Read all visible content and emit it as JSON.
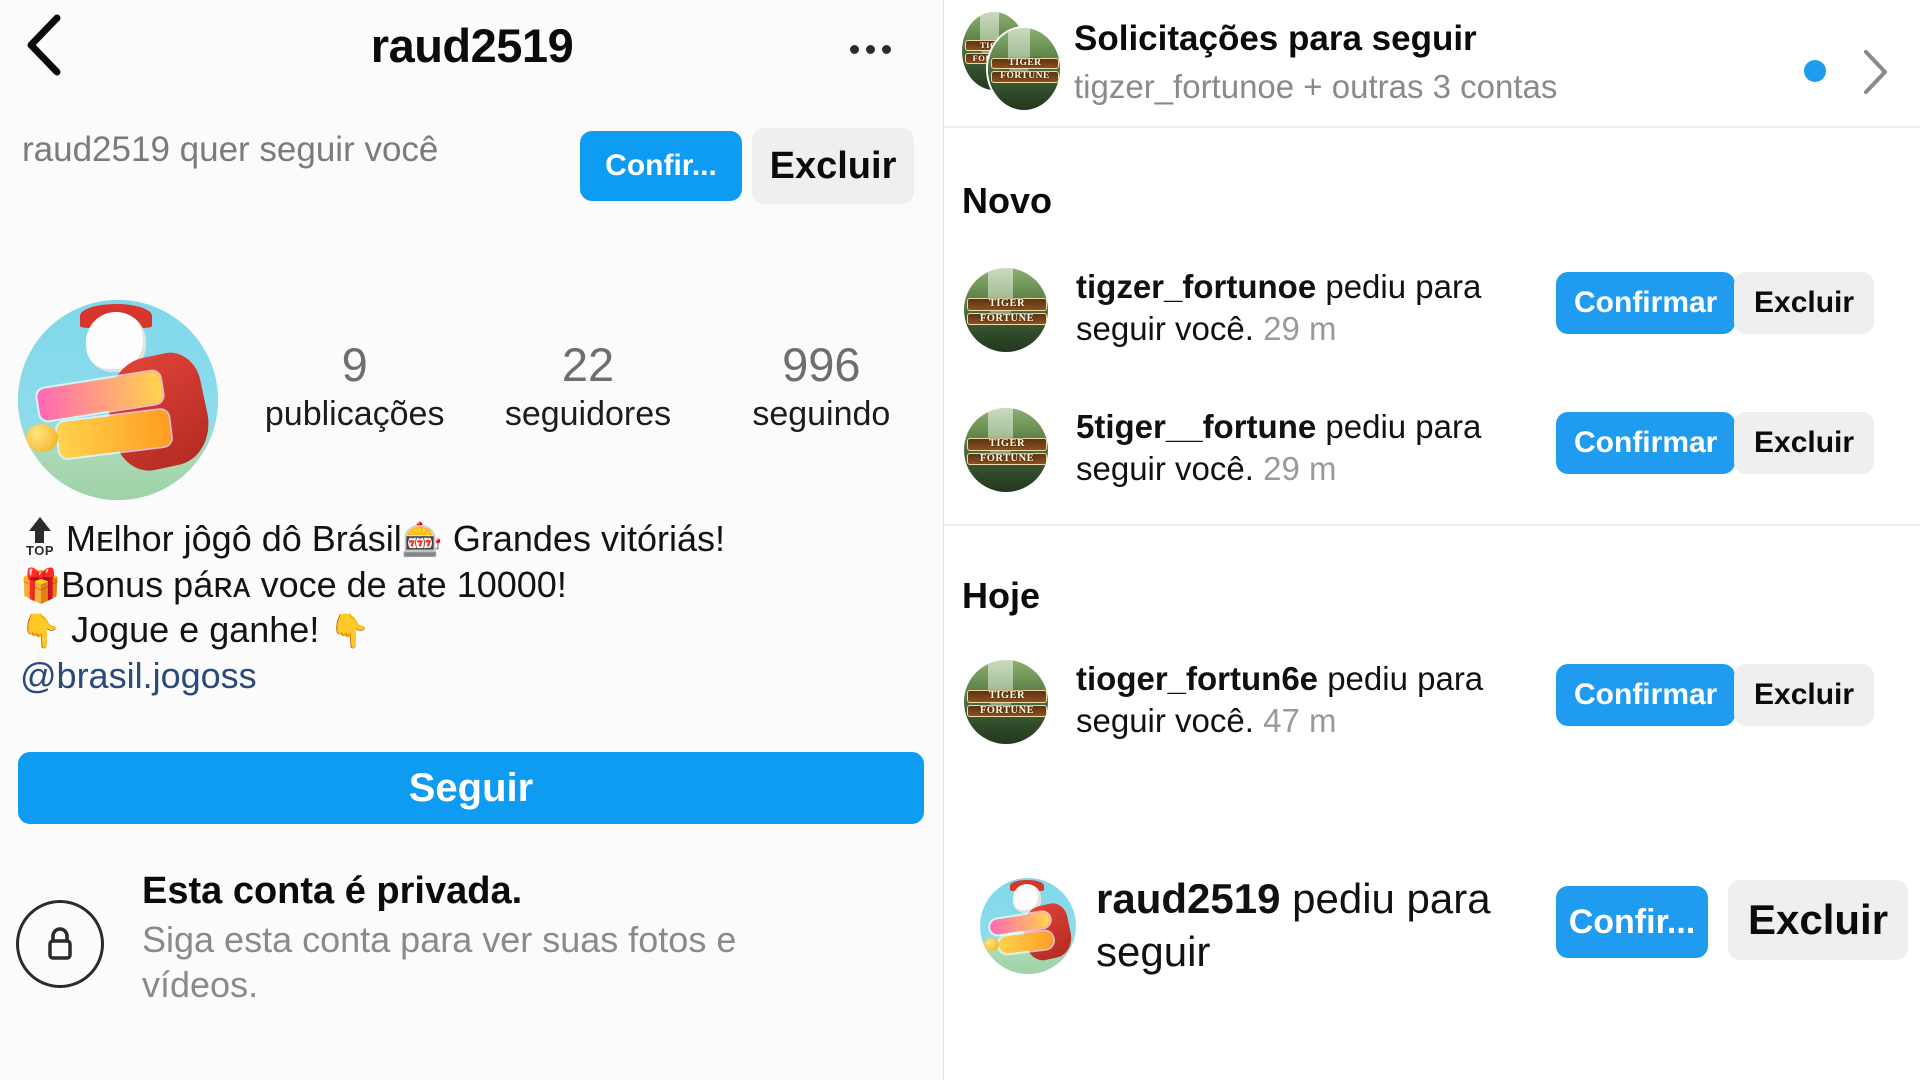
{
  "colors": {
    "accent_blue": "#0e9bf2",
    "row_blue": "#1f9bf0",
    "grey_button": "#efefef",
    "muted_text": "#8a8a8a",
    "left_bg": "#fbfbfb"
  },
  "profile": {
    "header": {
      "back_icon": "chevron-left-icon",
      "title": "raud2519",
      "more_icon": "more-options-icon"
    },
    "request_banner": {
      "text": "raud2519 quer seguir você",
      "confirm_label": "Confir...",
      "delete_label": "Excluir"
    },
    "avatar": "profile-avatar-raud2519",
    "stats": [
      {
        "num": "9",
        "label": "publicações"
      },
      {
        "num": "22",
        "label": "seguidores"
      },
      {
        "num": "996",
        "label": "seguindo"
      }
    ],
    "bio": {
      "line1_emoji": "top-arrow-emoji",
      "line1": "Mᴇlhor jôgô dô Brásil",
      "line1_emoji2": "🎰",
      "line1b": " Grandes vitóriás!",
      "line2_emoji": "🎁",
      "line2": "Bonus páʀᴀ voce  de ate 10000!",
      "line3_emoji": "👇",
      "line3": " Jogue e ganhe! ",
      "line3_emoji2": "👇",
      "handle": "@brasil.jogoss"
    },
    "follow_button": "Seguir",
    "private": {
      "lock_icon": "lock-icon",
      "title": "Esta conta é privada.",
      "subtitle": "Siga esta conta para ver suas fotos e vídeos."
    }
  },
  "requests": {
    "header": {
      "title": "Solicitações para seguir",
      "subtitle": "tigzer_fortunoe + outras 3 contas",
      "unread_dot": "unread-dot",
      "chevron_icon": "chevron-right-icon"
    },
    "sections": [
      {
        "label": "Novo"
      },
      {
        "label": "Hoje"
      }
    ],
    "items": [
      {
        "avatar": "tiger-fortune-avatar",
        "username": "tigzer_fortunoe",
        "action": " pediu para seguir você.",
        "time": "29 m",
        "confirm_label": "Confirmar",
        "delete_label": "Excluir"
      },
      {
        "avatar": "tiger-fortune-avatar",
        "username": "5tiger__fortune",
        "action": " pediu para seguir você.",
        "time": "29 m",
        "confirm_label": "Confirmar",
        "delete_label": "Excluir"
      },
      {
        "avatar": "tiger-fortune-avatar",
        "username": "tioger_fortun6e",
        "action": " pediu para seguir você.",
        "time": "47 m",
        "confirm_label": "Confirmar",
        "delete_label": "Excluir"
      }
    ],
    "highlight_item": {
      "avatar": "profile-avatar-raud2519",
      "username": "raud2519",
      "action": " pediu para seguir",
      "confirm_label": "Confir...",
      "delete_label": "Excluir"
    }
  }
}
